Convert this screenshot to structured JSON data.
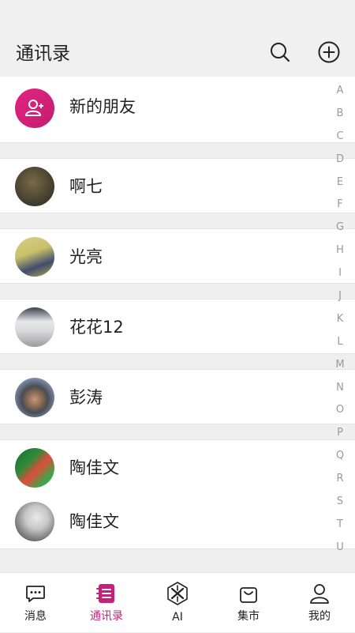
{
  "header": {
    "title": "通讯录",
    "search_icon": "search-icon",
    "add_icon": "plus-circle-icon"
  },
  "new_friends": {
    "label": "新的朋友",
    "icon": "add-user-icon",
    "accent": "#d6217a"
  },
  "contacts": [
    {
      "name": "啊七",
      "avatar_colors": [
        "#3e3a2e",
        "#7a6a45"
      ]
    },
    {
      "name": "光亮",
      "avatar_colors": [
        "#c9c06a",
        "#3e4d6e"
      ]
    },
    {
      "name": "花花12",
      "avatar_colors": [
        "#d9d9dc",
        "#3a3f4a"
      ]
    },
    {
      "name": "彭涛",
      "avatar_colors": [
        "#8aa0c4",
        "#4a4d52"
      ]
    },
    {
      "name": "陶佳文",
      "avatar_colors": [
        "#2e8b3a",
        "#e24a3a"
      ]
    },
    {
      "name": "陶佳文",
      "avatar_colors": [
        "#c8c8c8",
        "#6a6a6a"
      ]
    }
  ],
  "index_letters": [
    "A",
    "B",
    "C",
    "D",
    "E",
    "F",
    "G",
    "H",
    "I",
    "J",
    "K",
    "L",
    "M",
    "N",
    "O",
    "P",
    "Q",
    "R",
    "S",
    "T",
    "U"
  ],
  "tabs": [
    {
      "label": "消息",
      "icon": "chat-bubble-icon",
      "active": false
    },
    {
      "label": "通讯录",
      "icon": "contacts-book-icon",
      "active": true
    },
    {
      "label": "AI",
      "icon": "ai-knot-icon",
      "active": false
    },
    {
      "label": "集市",
      "icon": "shopping-bag-icon",
      "active": false
    },
    {
      "label": "我的",
      "icon": "profile-icon",
      "active": false
    }
  ],
  "colors": {
    "accent": "#c81f7b",
    "background": "#efefef"
  }
}
